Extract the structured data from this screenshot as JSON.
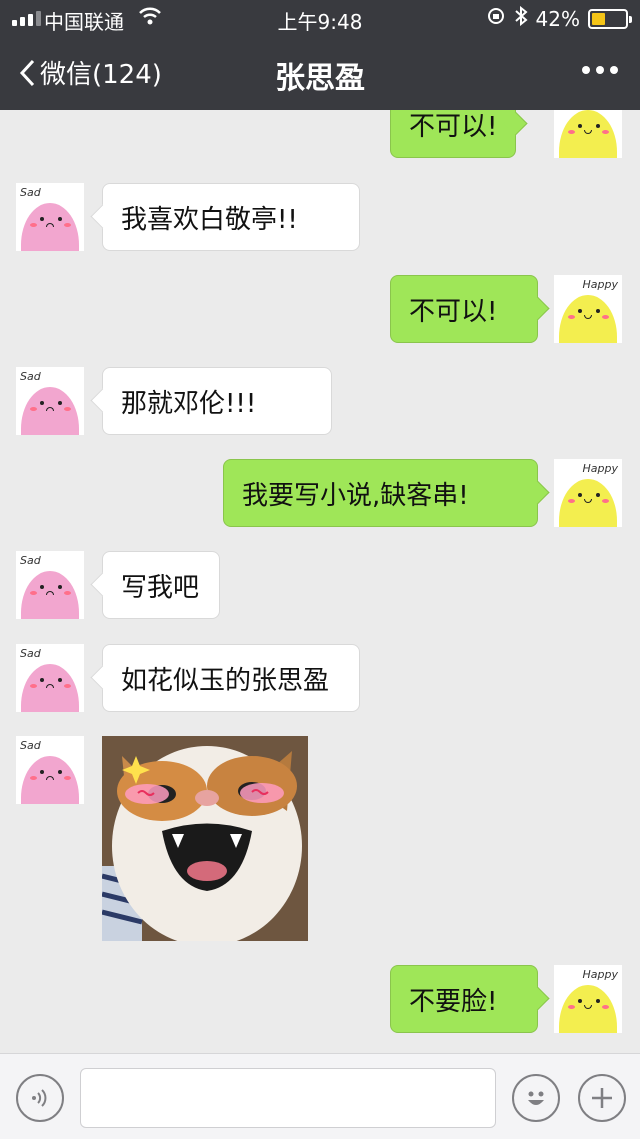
{
  "status_bar": {
    "carrier": "中国联通",
    "time": "上午9:48",
    "battery_percent": "42%",
    "battery_level": 0.42,
    "icons": [
      "signal-icon",
      "wifi-icon",
      "lock-rotation-icon",
      "bluetooth-icon",
      "battery-icon"
    ]
  },
  "nav": {
    "back_label": "微信(124)",
    "title": "张思盈",
    "more_icon": "more-dots-icon"
  },
  "avatars": {
    "sad_tag": "Sad",
    "happy_tag": "Happy"
  },
  "messages": [
    {
      "side": "right",
      "text": "不可以!"
    },
    {
      "side": "left",
      "text": "我喜欢白敬亭!!"
    },
    {
      "side": "right",
      "text": "不可以!"
    },
    {
      "side": "left",
      "text": "那就邓伦!!!"
    },
    {
      "side": "right",
      "text": "我要写小说,缺客串!"
    },
    {
      "side": "left",
      "text": "写我吧"
    },
    {
      "side": "left",
      "text": "如花似玉的张思盈"
    },
    {
      "side": "left",
      "type": "image",
      "description_icon": "cat-sticker-image"
    },
    {
      "side": "right",
      "text": "不要脸!"
    }
  ],
  "input_bar": {
    "voice_icon": "voice-icon",
    "emoji_icon": "emoji-icon",
    "plus_icon": "plus-icon"
  },
  "colors": {
    "nav_bg": "#393a3f",
    "chat_bg": "#ebebeb",
    "bubble_self": "#9fe658",
    "bubble_other": "#ffffff",
    "battery": "#f5c518"
  }
}
